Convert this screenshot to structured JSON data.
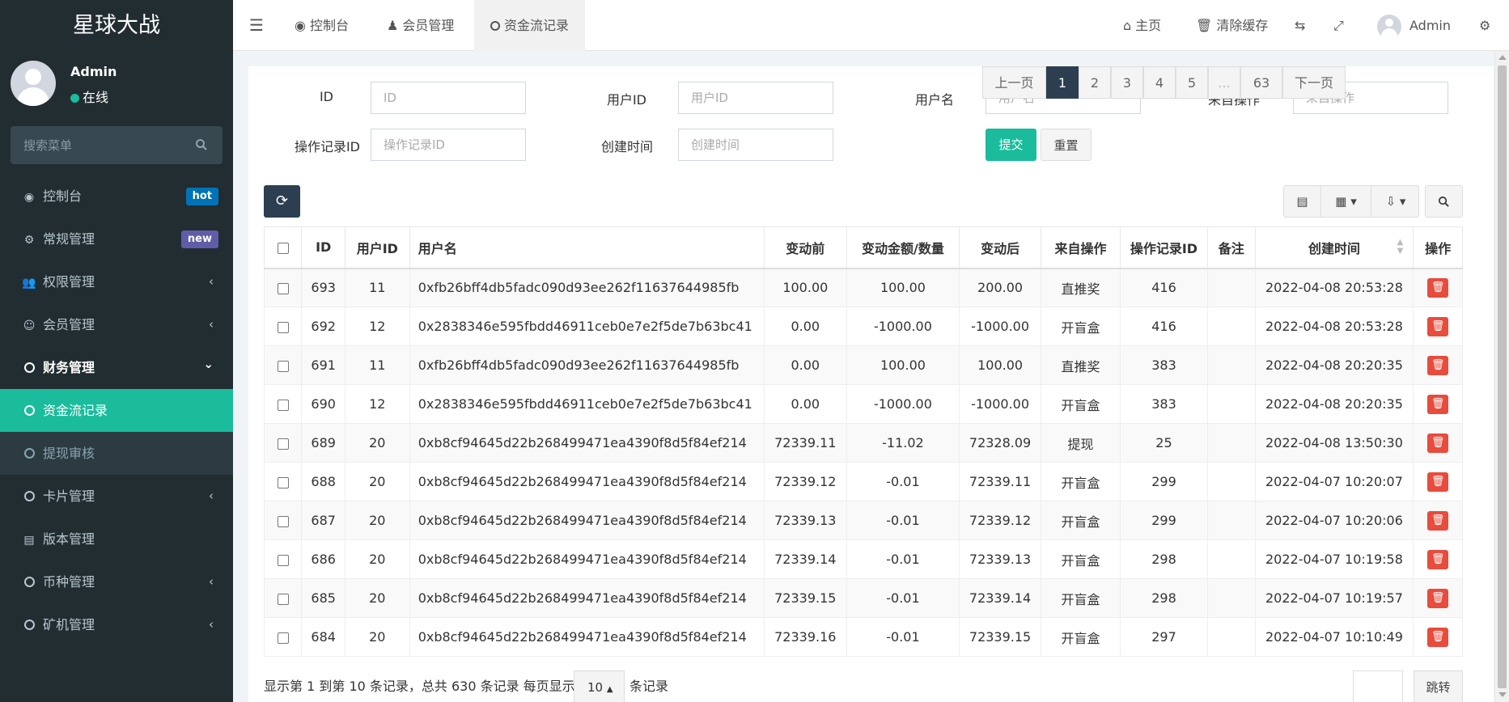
{
  "app": {
    "brand": "星球大战"
  },
  "user": {
    "name": "Admin",
    "status": "在线"
  },
  "sidebar": {
    "search_placeholder": "搜索菜单",
    "items": [
      {
        "label": "控制台",
        "icon": "dashboard-icon",
        "badge": "hot",
        "badge_color": "#0073b7"
      },
      {
        "label": "常规管理",
        "icon": "cogs-icon",
        "badge": "new",
        "badge_color": "#605ca8"
      },
      {
        "label": "权限管理",
        "icon": "group-icon",
        "arrow": "‹"
      },
      {
        "label": "会员管理",
        "icon": "user-circle-icon",
        "arrow": "‹"
      },
      {
        "label": "财务管理",
        "icon": "circle-icon",
        "arrow": "⌄"
      },
      {
        "label": "资金流记录",
        "icon": "circle-icon"
      },
      {
        "label": "提现审核",
        "icon": "circle-icon"
      },
      {
        "label": "卡片管理",
        "icon": "circle-icon",
        "arrow": "‹"
      },
      {
        "label": "版本管理",
        "icon": "file-icon"
      },
      {
        "label": "币种管理",
        "icon": "circle-icon",
        "arrow": "‹"
      },
      {
        "label": "矿机管理",
        "icon": "circle-icon",
        "arrow": "‹"
      }
    ]
  },
  "header": {
    "tabs": [
      {
        "label": "控制台",
        "icon": "dashboard-icon"
      },
      {
        "label": "会员管理",
        "icon": "user-icon"
      },
      {
        "label": "资金流记录",
        "icon": "circle-icon"
      }
    ],
    "home": "主页",
    "clear_cache": "清除缓存",
    "admin": "Admin"
  },
  "filters": {
    "id": {
      "label": "ID",
      "placeholder": "ID"
    },
    "user_id": {
      "label": "用户ID",
      "placeholder": "用户ID"
    },
    "username": {
      "label": "用户名",
      "placeholder": "用户名"
    },
    "source": {
      "label": "来自操作",
      "placeholder": "来自操作"
    },
    "record_id": {
      "label": "操作记录ID",
      "placeholder": "操作记录ID"
    },
    "created": {
      "label": "创建时间",
      "placeholder": "创建时间"
    },
    "submit": "提交",
    "reset": "重置"
  },
  "table": {
    "headers": [
      "ID",
      "用户ID",
      "用户名",
      "变动前",
      "变动金额/数量",
      "变动后",
      "来自操作",
      "操作记录ID",
      "备注",
      "创建时间",
      "操作"
    ],
    "rows": [
      [
        "693",
        "11",
        "0xfb26bff4db5fadc090d93ee262f11637644985fb",
        "100.00",
        "100.00",
        "200.00",
        "直推奖",
        "416",
        "",
        "2022-04-08 20:53:28"
      ],
      [
        "692",
        "12",
        "0x2838346e595fbdd46911ceb0e7e2f5de7b63bc41",
        "0.00",
        "-1000.00",
        "-1000.00",
        "开盲盒",
        "416",
        "",
        "2022-04-08 20:53:28"
      ],
      [
        "691",
        "11",
        "0xfb26bff4db5fadc090d93ee262f11637644985fb",
        "0.00",
        "100.00",
        "100.00",
        "直推奖",
        "383",
        "",
        "2022-04-08 20:20:35"
      ],
      [
        "690",
        "12",
        "0x2838346e595fbdd46911ceb0e7e2f5de7b63bc41",
        "0.00",
        "-1000.00",
        "-1000.00",
        "开盲盒",
        "383",
        "",
        "2022-04-08 20:20:35"
      ],
      [
        "689",
        "20",
        "0xb8cf94645d22b268499471ea4390f8d5f84ef214",
        "72339.11",
        "-11.02",
        "72328.09",
        "提现",
        "25",
        "",
        "2022-04-08 13:50:30"
      ],
      [
        "688",
        "20",
        "0xb8cf94645d22b268499471ea4390f8d5f84ef214",
        "72339.12",
        "-0.01",
        "72339.11",
        "开盲盒",
        "299",
        "",
        "2022-04-07 10:20:07"
      ],
      [
        "687",
        "20",
        "0xb8cf94645d22b268499471ea4390f8d5f84ef214",
        "72339.13",
        "-0.01",
        "72339.12",
        "开盲盒",
        "299",
        "",
        "2022-04-07 10:20:06"
      ],
      [
        "686",
        "20",
        "0xb8cf94645d22b268499471ea4390f8d5f84ef214",
        "72339.14",
        "-0.01",
        "72339.13",
        "开盲盒",
        "298",
        "",
        "2022-04-07 10:19:58"
      ],
      [
        "685",
        "20",
        "0xb8cf94645d22b268499471ea4390f8d5f84ef214",
        "72339.15",
        "-0.01",
        "72339.14",
        "开盲盒",
        "298",
        "",
        "2022-04-07 10:19:57"
      ],
      [
        "684",
        "20",
        "0xb8cf94645d22b268499471ea4390f8d5f84ef214",
        "72339.16",
        "-0.01",
        "72339.15",
        "开盲盒",
        "297",
        "",
        "2022-04-07 10:10:49"
      ]
    ]
  },
  "footer": {
    "summary": "显示第 1 到第 10 条记录，总共 630 条记录 每页显示",
    "page_size": "10",
    "suffix": "条记录",
    "prev": "上一页",
    "next": "下一页",
    "pages": [
      "1",
      "2",
      "3",
      "4",
      "5",
      "...",
      "63"
    ],
    "current_page": "1",
    "jump": "跳转"
  },
  "colors": {
    "accent": "#1abc9c",
    "sidebar": "#222d32",
    "danger": "#e74c3c",
    "dark": "#2c3e50"
  }
}
